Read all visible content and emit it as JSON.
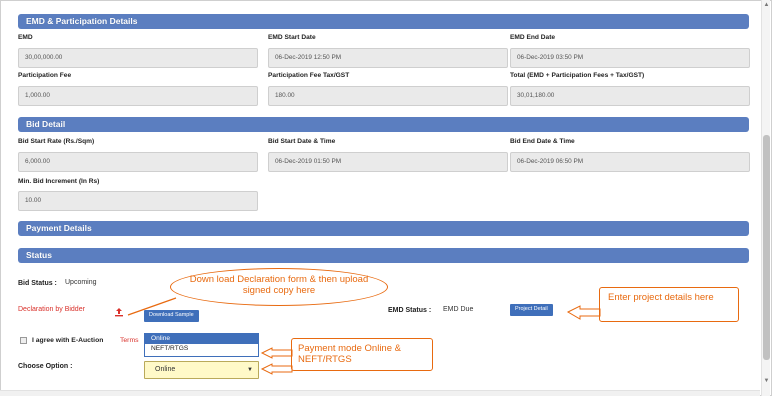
{
  "emd": {
    "header": "EMD & Participation Details",
    "emd_label": "EMD",
    "emd_value": "30,00,000.00",
    "start_label": "EMD Start Date",
    "start_value": "06-Dec-2019 12:50 PM",
    "end_label": "EMD End Date",
    "end_value": "06-Dec-2019 03:50 PM",
    "fee_label": "Participation Fee",
    "fee_value": "1,000.00",
    "tax_label": "Participation Fee Tax/GST",
    "tax_value": "180.00",
    "total_label": "Total (EMD + Participation Fees + Tax/GST)",
    "total_value": "30,01,180.00"
  },
  "bid": {
    "header": "Bid Detail",
    "rate_label": "Bid Start Rate (Rs./Sqm)",
    "rate_value": "6,000.00",
    "start_label": "Bid Start Date & Time",
    "start_value": "06-Dec-2019 01:50 PM",
    "end_label": "Bid End Date & Time",
    "end_value": "06-Dec-2019 06:50 PM",
    "increment_label": "Min. Bid Increment (In Rs)",
    "increment_value": "10.00"
  },
  "payment": {
    "header": "Payment Details"
  },
  "status": {
    "header": "Status",
    "bid_status_label": "Bid Status :",
    "bid_status_value": "Upcoming",
    "declaration_link": "Declaration by Bidder",
    "download_button": "Download Sample",
    "emd_status_label": "EMD Status :",
    "emd_status_value": "EMD Due",
    "project_button": "Project Detail",
    "agree_label": "I agree with E-Auction",
    "agree_link": "Terms",
    "choose_label": "Choose Option :",
    "options": [
      "Online",
      "NEFT/RTGS"
    ],
    "selected_option": "Online"
  },
  "annotations": {
    "declaration": "Down load Declaration form & then upload signed copy here",
    "project": "Enter project details here",
    "payment": "Payment mode Online & NEFT/RTGS"
  },
  "colors": {
    "header_bar": "#5b7ec0",
    "annotation": "#e86a10",
    "button": "#3f6fba",
    "link": "#d9312b"
  }
}
